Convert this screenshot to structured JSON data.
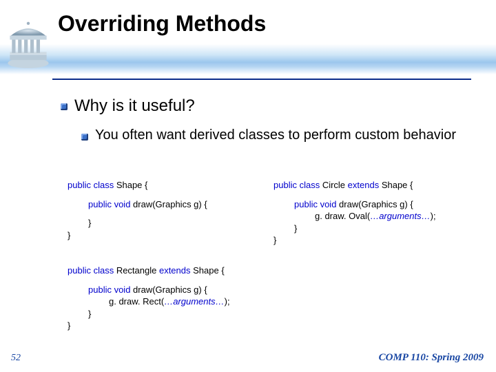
{
  "title": "Overriding Methods",
  "bullets": {
    "b1": "Why is it useful?",
    "b2": "You often want derived classes to perform custom behavior"
  },
  "code": {
    "col1": {
      "l1_pre": "public class",
      "l1_post": " Shape  {",
      "l2_pre": "public void",
      "l2_post": " draw(Graphics g)  {",
      "l3": "}",
      "l4": "}"
    },
    "col2": {
      "l1_pre": "public class",
      "l1_mid": " Circle ",
      "l1_ext_pre": "extends",
      "l1_ext_post": " Shape  {",
      "l2_pre": "public void",
      "l2_post": " draw(Graphics g)  {",
      "l3_a": "g. draw. Oval(",
      "l3_arg": "…arguments…",
      "l3_b": ");",
      "l4": "}",
      "l5": "}"
    },
    "rect": {
      "l1_pre": "public class",
      "l1_mid": " Rectangle ",
      "l1_ext_pre": "extends",
      "l1_ext_post": " Shape  {",
      "l2_pre": "public void",
      "l2_post": " draw(Graphics g)  {",
      "l3_a": "g. draw. Rect(",
      "l3_arg": "…arguments…",
      "l3_b": ");",
      "l4": "}",
      "l5": "}"
    }
  },
  "footer": {
    "left": "52",
    "right": "COMP 110: Spring 2009"
  }
}
